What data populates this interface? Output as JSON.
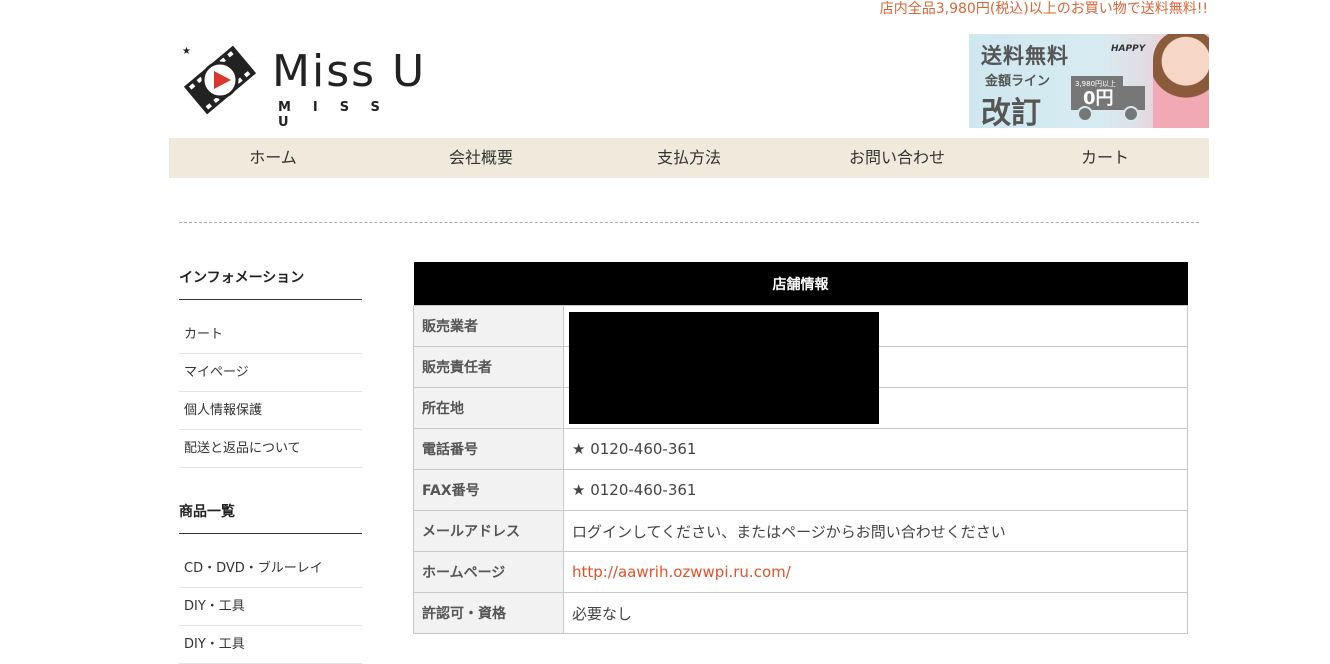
{
  "header": {
    "notice": "店内全品3,980円(税込)以上のお買い物で送料無料!!",
    "logo_title": "Miss U",
    "logo_sub": "MISS U",
    "banner": {
      "line1": "送料無料",
      "line2": "金額ライン",
      "line3": "改訂",
      "happy": "HAPPY",
      "threshold": "3,980円以上",
      "price": "0円"
    }
  },
  "nav": [
    "ホーム",
    "会社概要",
    "支払方法",
    "お問い合わせ",
    "カート"
  ],
  "sidebar": {
    "info_heading": "インフォメーション",
    "info_items": [
      "カート",
      "マイページ",
      "個人情報保護",
      "配送と返品について"
    ],
    "products_heading": "商品一覧",
    "product_items": [
      "CD・DVD・ブルーレイ",
      "DIY・工具",
      "DIY・工具"
    ]
  },
  "store_info": {
    "caption": "店舗情報",
    "rows": [
      {
        "label": "販売業者",
        "value": ""
      },
      {
        "label": "販売責任者",
        "value": ""
      },
      {
        "label": "所在地",
        "value": ""
      },
      {
        "label": "電話番号",
        "value": "★ 0120-460-361"
      },
      {
        "label": "FAX番号",
        "value": "★ 0120-460-361"
      },
      {
        "label": "メールアドレス",
        "value": "ログインしてください、またはページからお問い合わせください"
      },
      {
        "label": "ホームページ",
        "value": "http://aawrih.ozwwpi.ru.com/"
      },
      {
        "label": "許認可・資格",
        "value": "必要なし"
      }
    ]
  },
  "colors": {
    "accent": "#e0522a",
    "notice": "#d9663a",
    "nav_bg": "#efeadb",
    "table_header": "#000000"
  }
}
